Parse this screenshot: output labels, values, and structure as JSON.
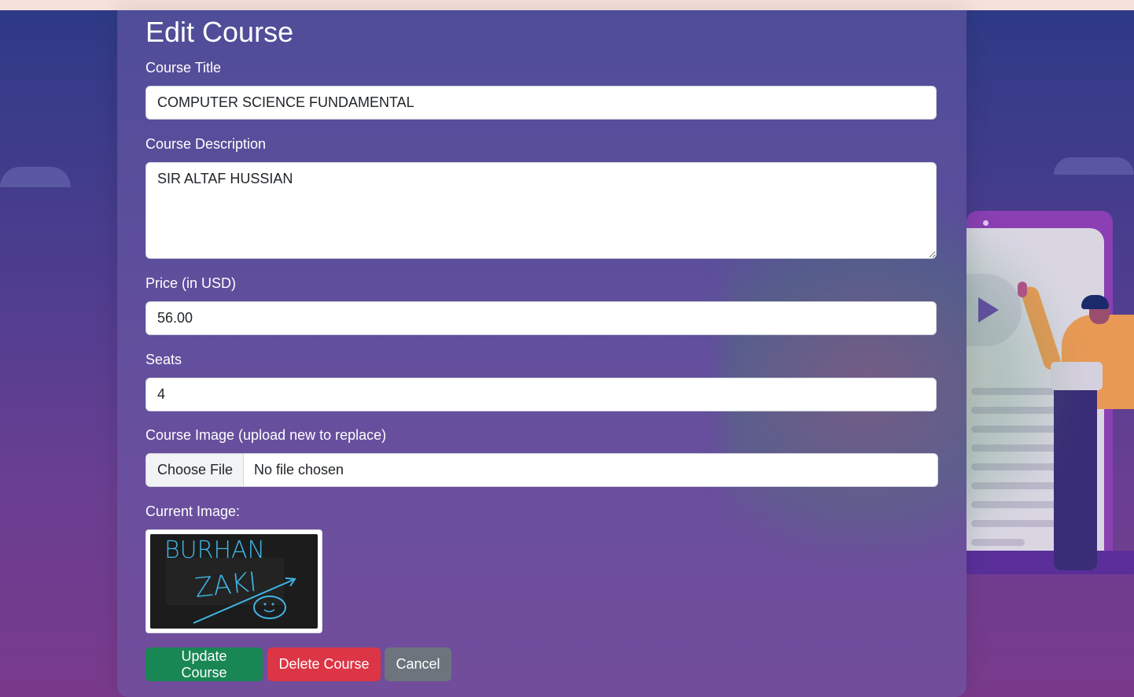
{
  "page": {
    "heading": "Edit Course"
  },
  "form": {
    "title_label": "Course Title",
    "title_value": "COMPUTER SCIENCE FUNDAMENTAL",
    "description_label": "Course Description",
    "description_value": "SIR ALTAF HUSSIAN",
    "price_label": "Price (in USD)",
    "price_value": "56.00",
    "seats_label": "Seats",
    "seats_value": "4",
    "image_label": "Course Image (upload new to replace)",
    "file_button_label": "Choose File",
    "file_status": "No file chosen",
    "current_image_label": "Current Image:",
    "current_image_text": [
      "BURHAN",
      "ZAKI"
    ]
  },
  "actions": {
    "update_label": "Update Course",
    "delete_label": "Delete Course",
    "cancel_label": "Cancel"
  },
  "colors": {
    "update": "#198754",
    "delete": "#dc3545",
    "cancel": "#6c757d",
    "image_ink": "#3fb6e6"
  }
}
